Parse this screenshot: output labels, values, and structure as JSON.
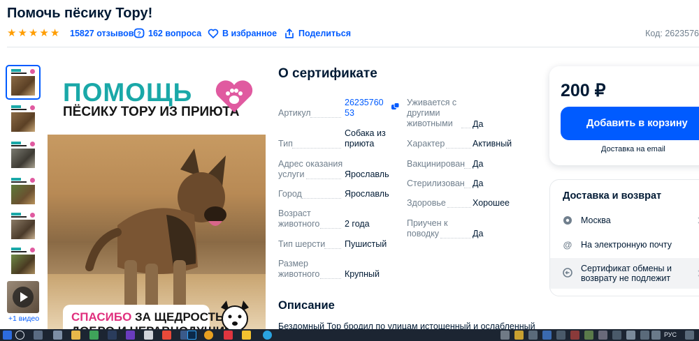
{
  "product": {
    "title": "Помочь пёсику Тору!",
    "reviews": "15827 отзывов",
    "questions": "162 вопроса",
    "favorites": "В избранное",
    "share": "Поделиться",
    "code": "Код: 2623576"
  },
  "gallery": {
    "thumb_count": 6,
    "video_label": "+1 видео"
  },
  "hero": {
    "title": "ПОМОЩЬ",
    "subtitle": "ПЁСИКУ ТОРУ ИЗ ПРИЮТА",
    "thanks_pink": "СПАСИБО",
    "thanks_rest": " ЗА ЩЕДРОСТЬ,",
    "thanks_line2": "ДОБРО И НЕРАВНОДУШИЕ"
  },
  "certificate": {
    "title": "О сертификате",
    "left": [
      {
        "label": "Артикул",
        "value": "26235760 53"
      },
      {
        "label": "Тип",
        "value": "Собака из приюта"
      },
      {
        "label": "Адрес оказания услуги",
        "value": "Ярославль"
      },
      {
        "label": "Город",
        "value": "Ярославль"
      },
      {
        "label": "Возраст животного",
        "value": "2 года"
      },
      {
        "label": "Тип шерсти",
        "value": "Пушистый"
      },
      {
        "label": "Размер животного",
        "value": "Крупный"
      }
    ],
    "right": [
      {
        "label": "Уживается с другими животными",
        "value": "Да"
      },
      {
        "label": "Характер",
        "value": "Активный"
      },
      {
        "label": "Вакцинирован",
        "value": "Да"
      },
      {
        "label": "Стерилизован",
        "value": "Да"
      },
      {
        "label": "Здоровье",
        "value": "Хорошее"
      },
      {
        "label": "Приучен к поводку",
        "value": "Да"
      }
    ]
  },
  "description": {
    "title": "Описание",
    "text": "Бездомный Тор бродил по улицам истощенный и ослабленный"
  },
  "buy": {
    "price": "200 ₽",
    "cart_button": "Добавить в корзину",
    "delivery_note": "Доставка на email"
  },
  "delivery": {
    "title": "Доставка и возврат",
    "city": "Москва",
    "method": "На электронную почту",
    "return_line1": "Сертификат обмены и",
    "return_line2": "возврату не подлежит"
  },
  "taskbar": {
    "lang": "РУС"
  },
  "colors": {
    "accent": "#005bff",
    "star": "#ff9d00",
    "teal": "#1aa8a8",
    "pink": "#e0307e"
  },
  "rating": {
    "stars": 5,
    "max": 5
  }
}
